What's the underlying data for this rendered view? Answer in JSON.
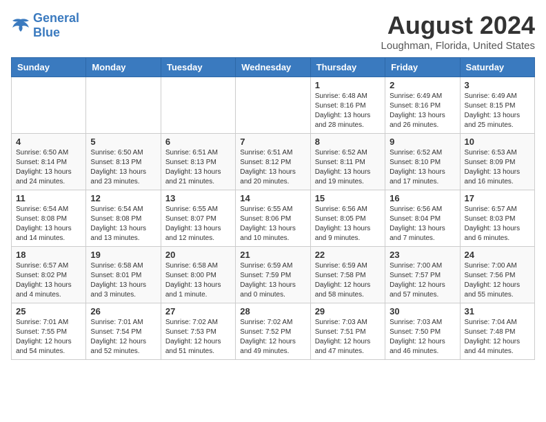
{
  "header": {
    "logo_general": "General",
    "logo_blue": "Blue",
    "main_title": "August 2024",
    "subtitle": "Loughman, Florida, United States"
  },
  "weekdays": [
    "Sunday",
    "Monday",
    "Tuesday",
    "Wednesday",
    "Thursday",
    "Friday",
    "Saturday"
  ],
  "weeks": [
    [
      {
        "day": "",
        "info": ""
      },
      {
        "day": "",
        "info": ""
      },
      {
        "day": "",
        "info": ""
      },
      {
        "day": "",
        "info": ""
      },
      {
        "day": "1",
        "info": "Sunrise: 6:48 AM\nSunset: 8:16 PM\nDaylight: 13 hours\nand 28 minutes."
      },
      {
        "day": "2",
        "info": "Sunrise: 6:49 AM\nSunset: 8:16 PM\nDaylight: 13 hours\nand 26 minutes."
      },
      {
        "day": "3",
        "info": "Sunrise: 6:49 AM\nSunset: 8:15 PM\nDaylight: 13 hours\nand 25 minutes."
      }
    ],
    [
      {
        "day": "4",
        "info": "Sunrise: 6:50 AM\nSunset: 8:14 PM\nDaylight: 13 hours\nand 24 minutes."
      },
      {
        "day": "5",
        "info": "Sunrise: 6:50 AM\nSunset: 8:13 PM\nDaylight: 13 hours\nand 23 minutes."
      },
      {
        "day": "6",
        "info": "Sunrise: 6:51 AM\nSunset: 8:13 PM\nDaylight: 13 hours\nand 21 minutes."
      },
      {
        "day": "7",
        "info": "Sunrise: 6:51 AM\nSunset: 8:12 PM\nDaylight: 13 hours\nand 20 minutes."
      },
      {
        "day": "8",
        "info": "Sunrise: 6:52 AM\nSunset: 8:11 PM\nDaylight: 13 hours\nand 19 minutes."
      },
      {
        "day": "9",
        "info": "Sunrise: 6:52 AM\nSunset: 8:10 PM\nDaylight: 13 hours\nand 17 minutes."
      },
      {
        "day": "10",
        "info": "Sunrise: 6:53 AM\nSunset: 8:09 PM\nDaylight: 13 hours\nand 16 minutes."
      }
    ],
    [
      {
        "day": "11",
        "info": "Sunrise: 6:54 AM\nSunset: 8:08 PM\nDaylight: 13 hours\nand 14 minutes."
      },
      {
        "day": "12",
        "info": "Sunrise: 6:54 AM\nSunset: 8:08 PM\nDaylight: 13 hours\nand 13 minutes."
      },
      {
        "day": "13",
        "info": "Sunrise: 6:55 AM\nSunset: 8:07 PM\nDaylight: 13 hours\nand 12 minutes."
      },
      {
        "day": "14",
        "info": "Sunrise: 6:55 AM\nSunset: 8:06 PM\nDaylight: 13 hours\nand 10 minutes."
      },
      {
        "day": "15",
        "info": "Sunrise: 6:56 AM\nSunset: 8:05 PM\nDaylight: 13 hours\nand 9 minutes."
      },
      {
        "day": "16",
        "info": "Sunrise: 6:56 AM\nSunset: 8:04 PM\nDaylight: 13 hours\nand 7 minutes."
      },
      {
        "day": "17",
        "info": "Sunrise: 6:57 AM\nSunset: 8:03 PM\nDaylight: 13 hours\nand 6 minutes."
      }
    ],
    [
      {
        "day": "18",
        "info": "Sunrise: 6:57 AM\nSunset: 8:02 PM\nDaylight: 13 hours\nand 4 minutes."
      },
      {
        "day": "19",
        "info": "Sunrise: 6:58 AM\nSunset: 8:01 PM\nDaylight: 13 hours\nand 3 minutes."
      },
      {
        "day": "20",
        "info": "Sunrise: 6:58 AM\nSunset: 8:00 PM\nDaylight: 13 hours\nand 1 minute."
      },
      {
        "day": "21",
        "info": "Sunrise: 6:59 AM\nSunset: 7:59 PM\nDaylight: 13 hours\nand 0 minutes."
      },
      {
        "day": "22",
        "info": "Sunrise: 6:59 AM\nSunset: 7:58 PM\nDaylight: 12 hours\nand 58 minutes."
      },
      {
        "day": "23",
        "info": "Sunrise: 7:00 AM\nSunset: 7:57 PM\nDaylight: 12 hours\nand 57 minutes."
      },
      {
        "day": "24",
        "info": "Sunrise: 7:00 AM\nSunset: 7:56 PM\nDaylight: 12 hours\nand 55 minutes."
      }
    ],
    [
      {
        "day": "25",
        "info": "Sunrise: 7:01 AM\nSunset: 7:55 PM\nDaylight: 12 hours\nand 54 minutes."
      },
      {
        "day": "26",
        "info": "Sunrise: 7:01 AM\nSunset: 7:54 PM\nDaylight: 12 hours\nand 52 minutes."
      },
      {
        "day": "27",
        "info": "Sunrise: 7:02 AM\nSunset: 7:53 PM\nDaylight: 12 hours\nand 51 minutes."
      },
      {
        "day": "28",
        "info": "Sunrise: 7:02 AM\nSunset: 7:52 PM\nDaylight: 12 hours\nand 49 minutes."
      },
      {
        "day": "29",
        "info": "Sunrise: 7:03 AM\nSunset: 7:51 PM\nDaylight: 12 hours\nand 47 minutes."
      },
      {
        "day": "30",
        "info": "Sunrise: 7:03 AM\nSunset: 7:50 PM\nDaylight: 12 hours\nand 46 minutes."
      },
      {
        "day": "31",
        "info": "Sunrise: 7:04 AM\nSunset: 7:48 PM\nDaylight: 12 hours\nand 44 minutes."
      }
    ]
  ]
}
